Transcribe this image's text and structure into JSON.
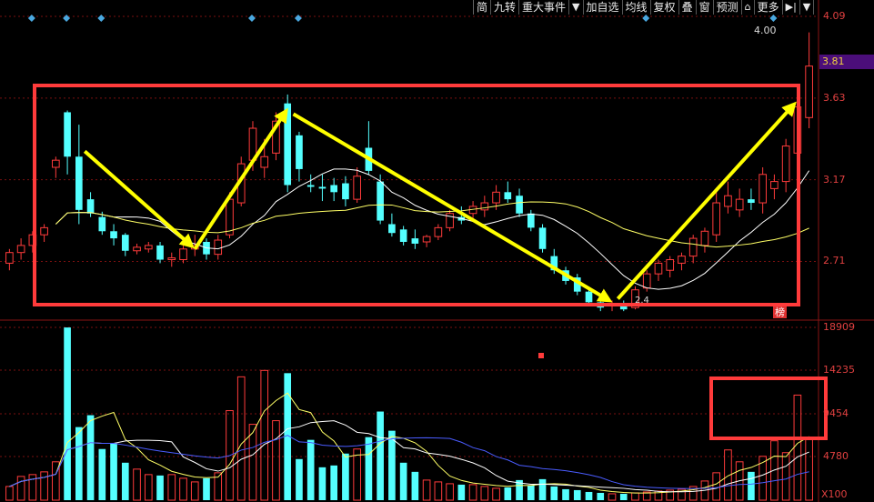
{
  "toolbar": {
    "items": [
      "简",
      "九转",
      "重大事件",
      "▼",
      "加自选",
      "均线",
      "复权",
      "叠",
      "窗",
      "预测",
      "⌂",
      "更多",
      "▶|",
      "▼"
    ]
  },
  "price_axis": {
    "labels": [
      "4.09",
      "3.63",
      "3.17",
      "2.71"
    ]
  },
  "current_price": "3.81",
  "max_marker": "4.00",
  "min_marker": "2.4",
  "volume_axis": {
    "labels": [
      "18909",
      "14235",
      "9454",
      "4780"
    ],
    "unit": "X100"
  },
  "bang_badge": "榜",
  "colors": {
    "up": "#ff3b3b",
    "down": "#54ffff",
    "ma_short": "#ffffff",
    "ma_long": "#ffff66",
    "vol_ma_long": "#4a5cff",
    "annotation_box": "#ff3b3b",
    "arrow": "#ffff00",
    "grid": "#7a1010"
  },
  "chart_data": [
    {
      "type": "candlestick",
      "ylim": [
        2.4,
        4.09
      ],
      "ohlc": [
        [
          2.7,
          2.78,
          2.66,
          2.76
        ],
        [
          2.76,
          2.84,
          2.72,
          2.8
        ],
        [
          2.8,
          2.88,
          2.76,
          2.86
        ],
        [
          2.86,
          2.92,
          2.82,
          2.9
        ],
        [
          3.24,
          3.3,
          3.18,
          3.28
        ],
        [
          3.55,
          3.56,
          3.2,
          3.3
        ],
        [
          3.3,
          3.48,
          2.92,
          3.0
        ],
        [
          3.06,
          3.1,
          2.96,
          2.98
        ],
        [
          2.96,
          2.99,
          2.86,
          2.88
        ],
        [
          2.88,
          2.92,
          2.8,
          2.84
        ],
        [
          2.86,
          2.87,
          2.74,
          2.77
        ],
        [
          2.77,
          2.81,
          2.75,
          2.79
        ],
        [
          2.78,
          2.82,
          2.76,
          2.8
        ],
        [
          2.8,
          2.82,
          2.7,
          2.72
        ],
        [
          2.72,
          2.76,
          2.68,
          2.73
        ],
        [
          2.72,
          2.8,
          2.7,
          2.78
        ],
        [
          2.78,
          2.86,
          2.74,
          2.8
        ],
        [
          2.82,
          2.84,
          2.72,
          2.75
        ],
        [
          2.75,
          2.86,
          2.72,
          2.83
        ],
        [
          2.86,
          3.1,
          2.84,
          3.06
        ],
        [
          3.04,
          3.3,
          3.02,
          3.26
        ],
        [
          3.28,
          3.5,
          3.22,
          3.46
        ],
        [
          3.24,
          3.4,
          3.18,
          3.3
        ],
        [
          3.32,
          3.55,
          3.28,
          3.5
        ],
        [
          3.6,
          3.65,
          3.1,
          3.14
        ],
        [
          3.42,
          3.44,
          3.16,
          3.23
        ],
        [
          3.14,
          3.2,
          3.1,
          3.13
        ],
        [
          3.13,
          3.2,
          3.05,
          3.12
        ],
        [
          3.14,
          3.18,
          3.05,
          3.1
        ],
        [
          3.15,
          3.19,
          3.02,
          3.06
        ],
        [
          3.06,
          3.24,
          3.04,
          3.19
        ],
        [
          3.35,
          3.5,
          3.2,
          3.22
        ],
        [
          3.16,
          3.2,
          2.92,
          2.94
        ],
        [
          2.92,
          2.98,
          2.85,
          2.87
        ],
        [
          2.89,
          2.91,
          2.8,
          2.82
        ],
        [
          2.84,
          2.89,
          2.78,
          2.81
        ],
        [
          2.82,
          2.86,
          2.79,
          2.85
        ],
        [
          2.85,
          2.92,
          2.83,
          2.9
        ],
        [
          2.9,
          3.0,
          2.88,
          2.98
        ],
        [
          2.96,
          3.02,
          2.92,
          2.94
        ],
        [
          2.98,
          3.05,
          2.94,
          3.02
        ],
        [
          3.0,
          3.08,
          2.96,
          3.04
        ],
        [
          3.04,
          3.14,
          3.0,
          3.1
        ],
        [
          3.1,
          3.16,
          3.04,
          3.06
        ],
        [
          3.08,
          3.12,
          2.96,
          2.98
        ],
        [
          2.98,
          3.0,
          2.88,
          2.9
        ],
        [
          2.9,
          2.92,
          2.76,
          2.78
        ],
        [
          2.74,
          2.78,
          2.64,
          2.66
        ],
        [
          2.66,
          2.68,
          2.58,
          2.6
        ],
        [
          2.62,
          2.64,
          2.52,
          2.54
        ],
        [
          2.54,
          2.56,
          2.46,
          2.48
        ],
        [
          2.48,
          2.5,
          2.43,
          2.45
        ],
        [
          2.46,
          2.49,
          2.43,
          2.47
        ],
        [
          2.47,
          2.49,
          2.43,
          2.44
        ],
        [
          2.45,
          2.57,
          2.44,
          2.55
        ],
        [
          2.56,
          2.66,
          2.54,
          2.64
        ],
        [
          2.64,
          2.72,
          2.6,
          2.7
        ],
        [
          2.66,
          2.74,
          2.62,
          2.72
        ],
        [
          2.7,
          2.76,
          2.66,
          2.74
        ],
        [
          2.74,
          2.86,
          2.7,
          2.84
        ],
        [
          2.8,
          2.9,
          2.76,
          2.88
        ],
        [
          2.86,
          3.12,
          2.82,
          3.04
        ],
        [
          3.02,
          3.16,
          2.98,
          3.08
        ],
        [
          3.0,
          3.12,
          2.96,
          3.06
        ],
        [
          3.06,
          3.12,
          3.0,
          3.04
        ],
        [
          3.04,
          3.24,
          2.98,
          3.2
        ],
        [
          3.12,
          3.2,
          3.06,
          3.16
        ],
        [
          3.16,
          3.4,
          3.1,
          3.36
        ],
        [
          3.32,
          3.64,
          3.26,
          3.58
        ],
        [
          3.52,
          4.0,
          3.46,
          3.81
        ]
      ]
    },
    {
      "type": "bar",
      "ylim": [
        0,
        18909
      ],
      "values": [
        1500,
        2600,
        2800,
        3100,
        4200,
        18900,
        8000,
        9300,
        5600,
        6200,
        4100,
        3400,
        2800,
        2700,
        2800,
        2400,
        2000,
        2400,
        3000,
        9800,
        13500,
        8300,
        14200,
        8700,
        13900,
        4500,
        6600,
        3600,
        3800,
        5100,
        5600,
        6900,
        9700,
        7600,
        4100,
        3100,
        2200,
        2000,
        1800,
        1700,
        1700,
        1500,
        1300,
        1400,
        2200,
        1600,
        2300,
        1500,
        1200,
        1100,
        900,
        800,
        700,
        700,
        800,
        900,
        1000,
        1100,
        1200,
        1500,
        2100,
        3000,
        5500,
        4200,
        3100,
        4800,
        6500,
        5200,
        11500,
        6800
      ]
    }
  ]
}
